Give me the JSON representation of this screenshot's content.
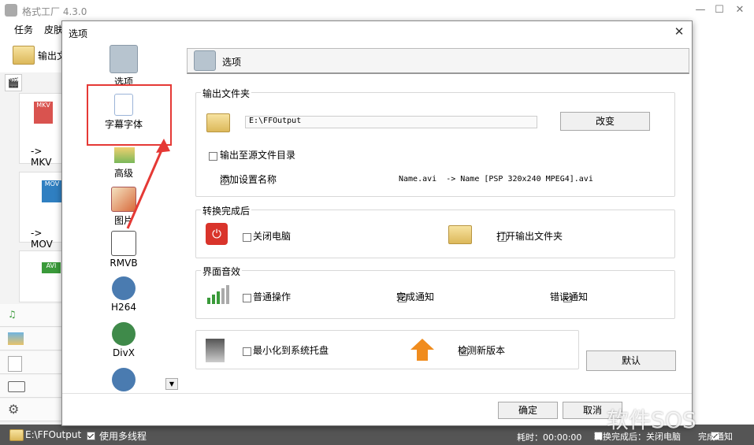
{
  "app": {
    "title": "格式工厂 4.3.0",
    "menu": [
      "任务",
      "皮肤"
    ],
    "toolbar_output": "输出文",
    "formats": [
      {
        "badge": "MKV",
        "label": "-> MKV"
      },
      {
        "badge": "MOV",
        "label": "-> MOV"
      },
      {
        "badge": "AVI",
        "label": ""
      }
    ],
    "status": {
      "path": "E:\\FFOutput",
      "multithread_label": "使用多线程",
      "elapsed": "耗时：00:00:00",
      "after_convert_label": "转换完成后：关闭电脑",
      "notify_label": "完成通知"
    }
  },
  "dialog": {
    "title": "选项",
    "categories": [
      {
        "label": "选项",
        "icon": "gear-icon",
        "color": "#8a9aa8"
      },
      {
        "label": "字幕字体",
        "icon": "document-icon",
        "color": "#5b8fd6"
      },
      {
        "label": "高级",
        "icon": "landscape-icon",
        "color": "#79b85a"
      },
      {
        "label": "图片",
        "icon": "image-icon",
        "color": "#d86a3c"
      },
      {
        "label": "RMVB",
        "icon": "rmvb-icon",
        "color": "#555555"
      },
      {
        "label": "H264",
        "icon": "film-reel-icon",
        "color": "#4a7bb0"
      },
      {
        "label": "DivX",
        "icon": "film-reel-icon",
        "color": "#3f8a4a"
      }
    ],
    "header": "选项",
    "output_group": {
      "title": "输出文件夹",
      "path": "E:\\FFOutput",
      "change_btn": "改变",
      "output_to_source": "输出至源文件目录",
      "add_setting_name": "添加设置名称",
      "example": "Name.avi  -> Name [PSP 320x240 MPEG4].avi"
    },
    "after_group": {
      "title": "转换完成后",
      "shutdown": "关闭电脑",
      "open_folder": "打开输出文件夹"
    },
    "sound_group": {
      "title": "界面音效",
      "normal_op": "普通操作",
      "done_notify": "完成通知",
      "error_notify": "错误通知"
    },
    "misc": {
      "minimize_tray": "最小化到系统托盘",
      "check_update": "检测新版本"
    },
    "default_btn": "默认",
    "ok_btn": "确定",
    "cancel_btn": "取消"
  },
  "watermark": "软件SOS",
  "colors": {
    "highlight": "#e53935",
    "status_bg": "#555555"
  }
}
